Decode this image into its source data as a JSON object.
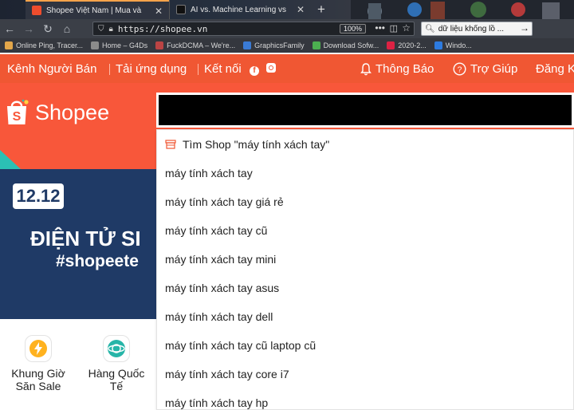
{
  "browser": {
    "tabs": [
      {
        "title": "Shopee Việt Nam | Mua và",
        "favicon_color": "#ee4d2d"
      },
      {
        "title": "AI vs. Machine Learning vs",
        "favicon_color": "#1a1a1a"
      }
    ],
    "address": "https://shopee.vn",
    "zoom": "100%",
    "search_query": "dữ liệu khổng lồ ... ",
    "bookmarks": [
      {
        "label": "Online Ping, Tracer...",
        "color": "#e2a64a"
      },
      {
        "label": "Home – G4Ds",
        "color": "#8b8b8b"
      },
      {
        "label": "FuckDCMA – We're...",
        "color": "#b44"
      },
      {
        "label": "GraphicsFamily",
        "color": "#3a7bd5"
      },
      {
        "label": "Download Sofw...",
        "color": "#4caf50"
      },
      {
        "label": "2020-2...",
        "color": "#d24"
      },
      {
        "label": "Windo...",
        "color": "#2d7be0"
      }
    ]
  },
  "topbar": {
    "seller": "Kênh Người Bán",
    "app": "Tải ứng dụng",
    "connect": "Kết nối",
    "fb_icon_letter": "f",
    "notifications": "Thông Báo",
    "help": "Trợ Giúp",
    "register": "Đăng K"
  },
  "header": {
    "logo": "Shopee",
    "brand_color": "#f8573a"
  },
  "banner": {
    "badge": "12.12",
    "title": "ĐIỆN TỬ SI",
    "hashtag": "#shopeete"
  },
  "quick_links": [
    {
      "label": "Khung Giờ Săn Sale",
      "icon": "lightning-icon"
    },
    {
      "label": "Hàng Quốc Tế",
      "icon": "globe-icon"
    }
  ],
  "suggestions": {
    "shop": "Tìm Shop \"máy tính xách tay\"",
    "items": [
      "máy tính xách tay",
      "máy tính xách tay giá rẻ",
      "máy tính xách tay cũ",
      "máy tính xách tay mini",
      "máy tính xách tay asus",
      "máy tính xách tay dell",
      "máy tính xách tay cũ laptop cũ",
      "máy tính xách tay core i7",
      "máy tính xách tay hp"
    ]
  }
}
